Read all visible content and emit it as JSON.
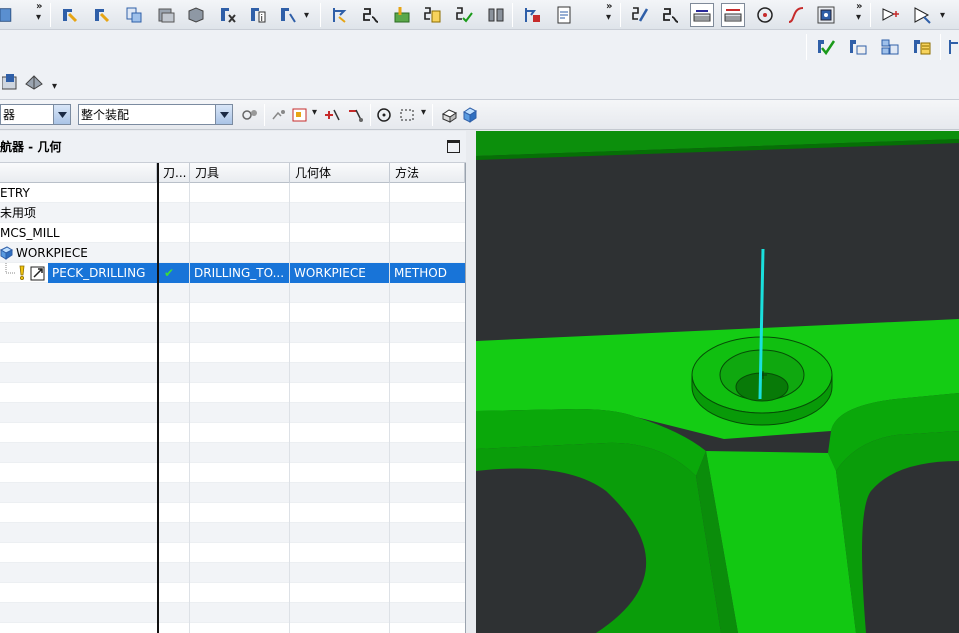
{
  "toolbar": {
    "more_glyph": "»",
    "dropdown_glyph": "▾"
  },
  "selection_bar": {
    "filter_combo_value": "器",
    "scope_combo_value": "整个装配"
  },
  "navigator": {
    "title": "航器 - 几何",
    "columns": [
      "刀...",
      "刀具",
      "几何体",
      "方法"
    ],
    "rows": [
      {
        "name": "ETRY",
        "check": "",
        "tool": "",
        "geometry": "",
        "method": ""
      },
      {
        "name": "未用项",
        "check": "",
        "tool": "",
        "geometry": "",
        "method": ""
      },
      {
        "name": "MCS_MILL",
        "check": "",
        "tool": "",
        "geometry": "",
        "method": ""
      },
      {
        "name": "WORKPIECE",
        "check": "",
        "tool": "",
        "geometry": "",
        "method": ""
      },
      {
        "name": "PECK_DRILLING",
        "check": "✔",
        "tool": "DRILLING_TO...",
        "geometry": "WORKPIECE",
        "method": "METHOD"
      }
    ]
  },
  "colors": {
    "selection": "#1874d8",
    "part_green": "#0fd30f",
    "tool_path": "#1ae0dd",
    "viewport_bg": "#2e3133"
  }
}
